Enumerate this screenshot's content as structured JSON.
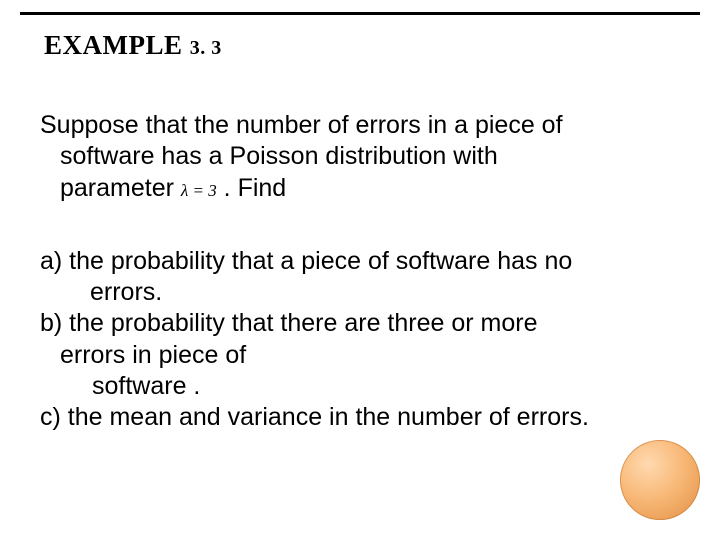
{
  "title_main": "EXAMPLE ",
  "title_num": "3. 3",
  "intro": {
    "line1": "Suppose that the number of errors in a piece of",
    "line2a": "software has a  Poisson distribution with",
    "line3a": "parameter  ",
    "formula": "λ = 3",
    "line3b": "  . Find"
  },
  "items": {
    "a1": "a)  the probability that a piece of software has no",
    "a2": "errors.",
    "b1": "b)  the probability that there  are three or more",
    "b2": "errors in piece of",
    "b3": "software .",
    "c1": "c)  the mean and variance in the number of errors."
  }
}
